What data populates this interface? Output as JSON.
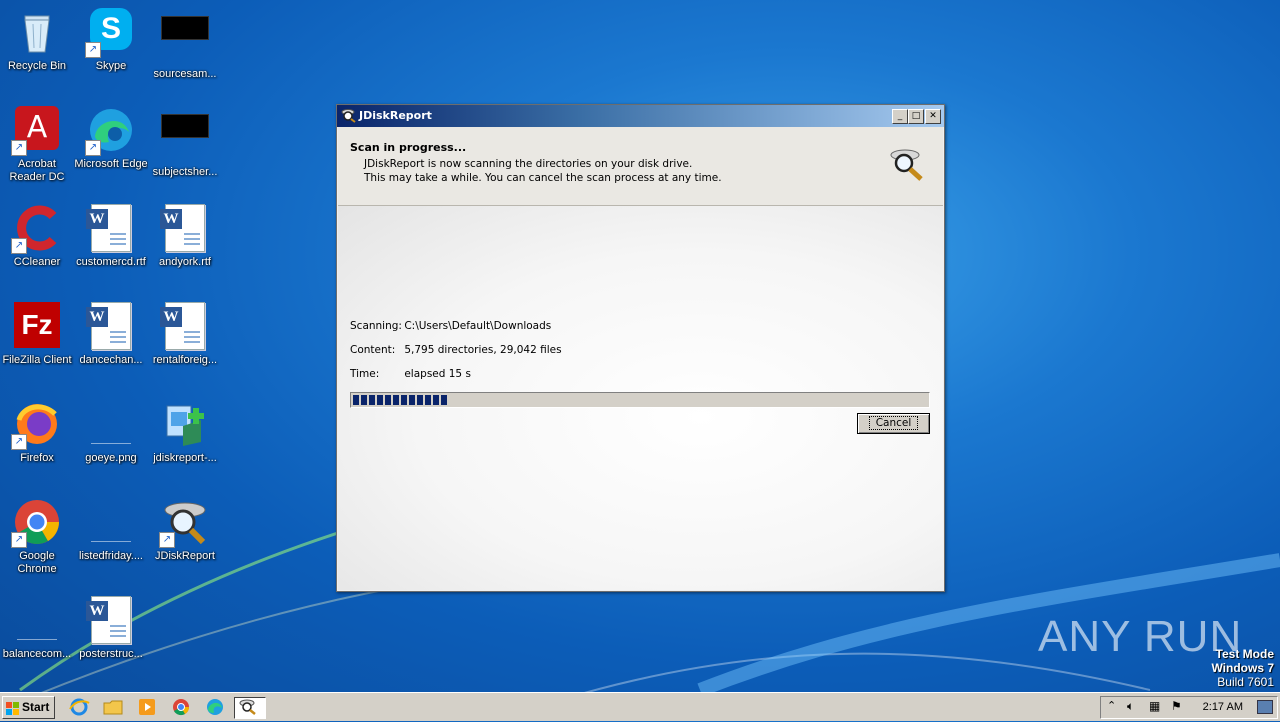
{
  "desktop": {
    "icons": [
      {
        "label": "Recycle Bin"
      },
      {
        "label": "Skype"
      },
      {
        "label": "sourcesam..."
      },
      {
        "label": "Acrobat Reader DC"
      },
      {
        "label": "Microsoft Edge"
      },
      {
        "label": "subjectsher..."
      },
      {
        "label": "CCleaner"
      },
      {
        "label": "customercd.rtf"
      },
      {
        "label": "andyork.rtf"
      },
      {
        "label": "FileZilla Client"
      },
      {
        "label": "dancechan..."
      },
      {
        "label": "rentalforeig..."
      },
      {
        "label": "Firefox"
      },
      {
        "label": "goeye.png"
      },
      {
        "label": "jdiskreport-..."
      },
      {
        "label": "Google Chrome"
      },
      {
        "label": "listedfriday...."
      },
      {
        "label": "JDiskReport"
      },
      {
        "label": "balancecom..."
      },
      {
        "label": "posterstruc..."
      }
    ]
  },
  "window": {
    "title": "JDiskReport",
    "controls": {
      "minimize": "_",
      "maximize": "□",
      "close": "✕"
    },
    "header": {
      "heading": "Scan in progress...",
      "line1": "JDiskReport is now scanning the directories on your disk drive.",
      "line2": "This may take a while. You can cancel the scan process at any time."
    },
    "scanning_label": "Scanning:",
    "scanning_value": "C:\\Users\\Default\\Downloads",
    "content_label": "Content:",
    "content_value": "5,795 directories, 29,042 files",
    "time_label": "Time:",
    "time_value": "elapsed 15 s",
    "progress_fraction": 0.17,
    "cancel_label": "Cancel"
  },
  "watermark": {
    "brand": "ANY RUN",
    "mode": "Test Mode",
    "os": "Windows 7",
    "build": "Build 7601"
  },
  "taskbar": {
    "start_label": "Start",
    "clock": "2:17 AM",
    "pinned": [
      "internet-explorer-icon",
      "folder-icon",
      "media-player-icon",
      "chrome-icon",
      "edge-icon",
      "jdiskreport-icon"
    ]
  },
  "colors": {
    "titlebar_start": "#0a246a",
    "titlebar_end": "#a6caf0",
    "progress": "#0a246a",
    "desktop": "#1b78d0"
  }
}
